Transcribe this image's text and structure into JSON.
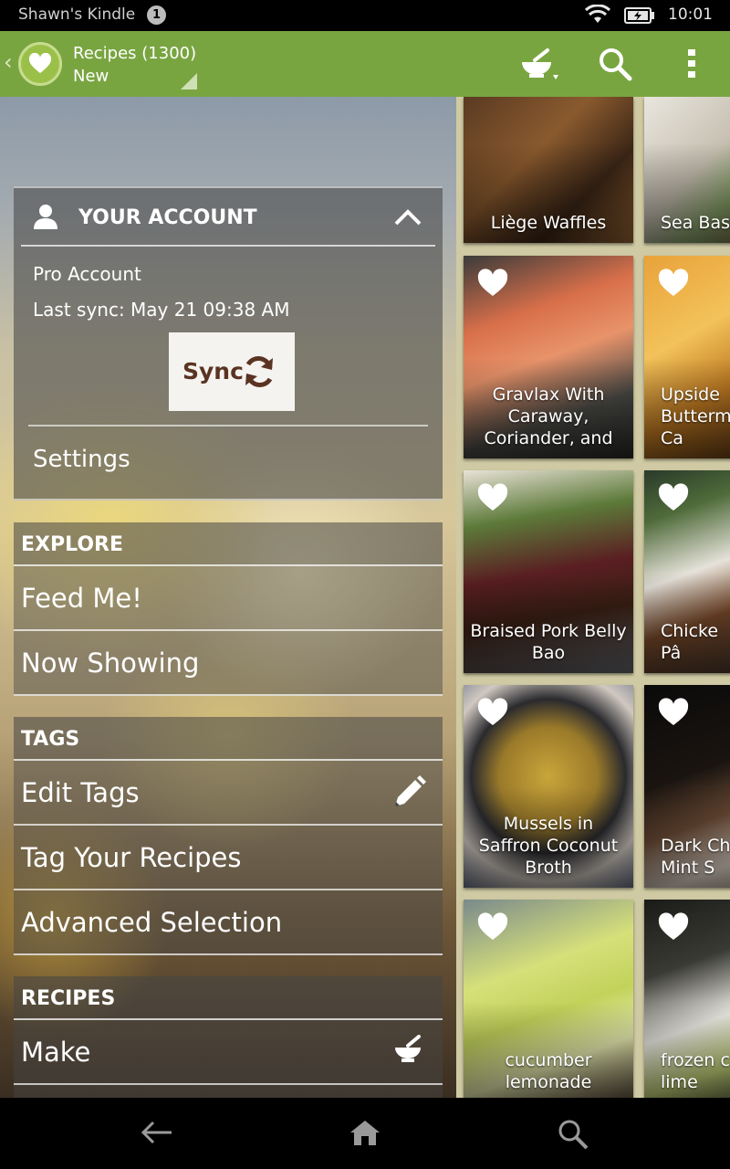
{
  "status_bar": {
    "device_name": "Shawn's Kindle",
    "notification_count": "1",
    "time": "10:01"
  },
  "action_bar": {
    "title": "Recipes (1300)",
    "subtitle": "New",
    "icons": [
      "bowl-icon",
      "search-icon",
      "overflow-menu-icon"
    ]
  },
  "drawer": {
    "account": {
      "header": "YOUR ACCOUNT",
      "plan": "Pro Account",
      "last_sync": "Last sync: May 21 09:38 AM",
      "sync_button": "Sync",
      "settings": "Settings"
    },
    "explore": {
      "header": "EXPLORE",
      "items": [
        "Feed Me!",
        "Now Showing"
      ]
    },
    "tags": {
      "header": "TAGS",
      "items": [
        "Edit Tags",
        "Tag Your Recipes",
        "Advanced Selection"
      ]
    },
    "recipes": {
      "header": "RECIPES",
      "items": [
        "Make"
      ]
    }
  },
  "recipes": [
    {
      "name": "Liège Waffles",
      "favorite": false
    },
    {
      "name": "Sea Bas",
      "favorite": false
    },
    {
      "name": "Gravlax With\nCaraway,\nCoriander, and",
      "favorite": true
    },
    {
      "name": "Upside\nButterm\nCa",
      "favorite": true
    },
    {
      "name": "Braised Pork Belly\nBao",
      "favorite": true
    },
    {
      "name": "Chicke\nPâ",
      "favorite": true
    },
    {
      "name": "Mussels in\nSaffron Coconut\nBroth",
      "favorite": true
    },
    {
      "name": "Dark Ch\nMint S",
      "favorite": true
    },
    {
      "name": "cucumber\nlemonade",
      "favorite": true
    },
    {
      "name": "frozen c\nlime",
      "favorite": true
    }
  ],
  "colors": {
    "action_bar": "#79a541",
    "sync_text": "#5a3323",
    "grid_background": "#cfcaa3"
  },
  "nav_bar": {
    "icons": [
      "back-arrow-icon",
      "home-icon",
      "search-icon"
    ]
  }
}
